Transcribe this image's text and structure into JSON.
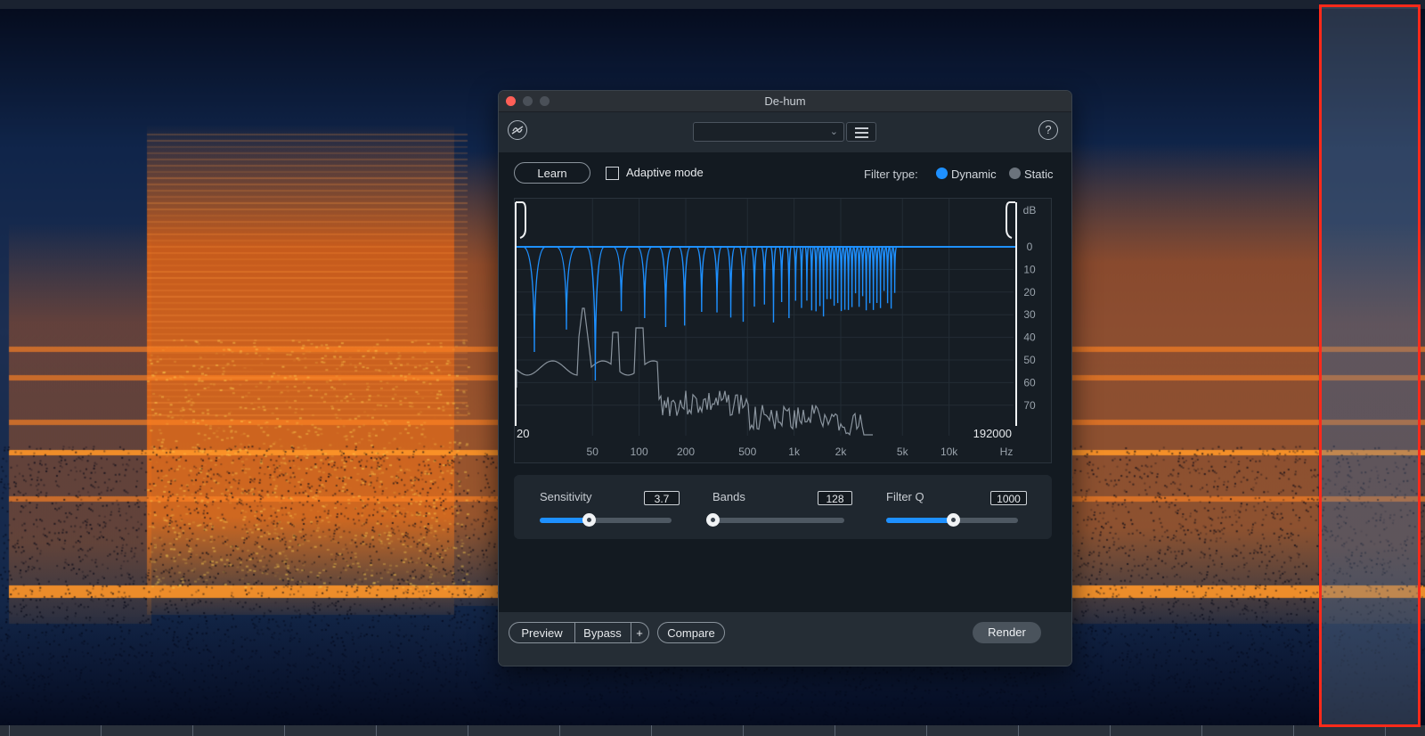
{
  "window": {
    "title": "De-hum"
  },
  "toolbar": {
    "preset_value": "",
    "help_label": "?"
  },
  "controls": {
    "learn_label": "Learn",
    "adaptive_label": "Adaptive mode",
    "adaptive_checked": false,
    "filter_type_label": "Filter type:",
    "filter_types": [
      {
        "label": "Dynamic",
        "selected": true
      },
      {
        "label": "Static",
        "selected": false
      }
    ]
  },
  "graph": {
    "db_unit": "dB",
    "db_ticks": [
      "0",
      "10",
      "20",
      "30",
      "40",
      "50",
      "60",
      "70"
    ],
    "freq_ticks": [
      "50",
      "100",
      "200",
      "500",
      "1k",
      "2k",
      "5k",
      "10k"
    ],
    "hz_unit": "Hz",
    "range_start": "20",
    "range_end": "192000"
  },
  "sliders": [
    {
      "label": "Sensitivity",
      "value": "3.7",
      "fraction": 0.37
    },
    {
      "label": "Bands",
      "value": "128",
      "fraction": 0.0
    },
    {
      "label": "Filter Q",
      "value": "1000",
      "fraction": 0.51
    }
  ],
  "footer": {
    "preview": "Preview",
    "bypass": "Bypass",
    "plus": "+",
    "compare": "Compare",
    "render": "Render"
  },
  "colors": {
    "accent": "#1e90ff",
    "selection": "#ff2a1a",
    "spectro_hot": "#ff8a1a",
    "spectro_cold": "#0a1a3a"
  }
}
